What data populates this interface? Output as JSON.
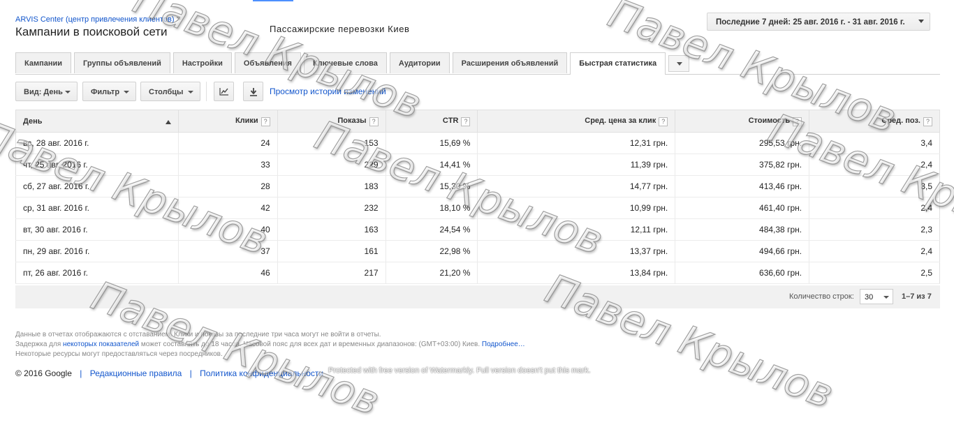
{
  "breadcrumb": {
    "account": "ARVIS Center (центр привлечения клиентов)",
    "separator": ">"
  },
  "page_title": "Кампании в поисковой сети",
  "campaign_name": "Пассажирские перевозки Киев",
  "date_range": "Последние 7 дней: 25 авг. 2016 г. - 31 авг. 2016 г.",
  "tabs": [
    {
      "label": "Кампании"
    },
    {
      "label": "Группы объявлений"
    },
    {
      "label": "Настройки"
    },
    {
      "label": "Объявления"
    },
    {
      "label": "Ключевые слова"
    },
    {
      "label": "Аудитории"
    },
    {
      "label": "Расширения объявлений"
    },
    {
      "label": "Быстрая статистика",
      "active": true
    }
  ],
  "toolbar": {
    "view": "Вид: День",
    "filter": "Фильтр",
    "columns": "Столбцы",
    "history_link": "Просмотр истории изменений"
  },
  "table": {
    "headers": [
      "День",
      "Клики",
      "Показы",
      "CTR",
      "Сред. цена за клик",
      "Стоимость",
      "Сред. поз."
    ],
    "help_glyph": "?",
    "rows": [
      [
        "вс, 28 авг. 2016 г.",
        "24",
        "153",
        "15,69 %",
        "12,31 грн.",
        "295,53 грн.",
        "3,4"
      ],
      [
        "чт, 25 авг. 2016 г.",
        "33",
        "229",
        "14,41 %",
        "11,39 грн.",
        "375,82 грн.",
        "2,4"
      ],
      [
        "сб, 27 авг. 2016 г.",
        "28",
        "183",
        "15,30 %",
        "14,77 грн.",
        "413,46 грн.",
        "3,5"
      ],
      [
        "ср, 31 авг. 2016 г.",
        "42",
        "232",
        "18,10 %",
        "10,99 грн.",
        "461,40 грн.",
        "2,4"
      ],
      [
        "вт, 30 авг. 2016 г.",
        "40",
        "163",
        "24,54 %",
        "12,11 грн.",
        "484,38 грн.",
        "2,3"
      ],
      [
        "пн, 29 авг. 2016 г.",
        "37",
        "161",
        "22,98 %",
        "13,37 грн.",
        "494,66 грн.",
        "2,4"
      ],
      [
        "пт, 26 авг. 2016 г.",
        "46",
        "217",
        "21,20 %",
        "13,84 грн.",
        "636,60 грн.",
        "2,5"
      ]
    ]
  },
  "pagination": {
    "rows_label": "Количество строк:",
    "rows_value": "30",
    "range": "1–7 из 7"
  },
  "notes": {
    "line1": "Данные в отчетах отображаются с отставанием. Клики и показы за последние три часа могут не войти в отчеты.",
    "line2_a": "Задержка для ",
    "line2_link": "некоторых показателей",
    "line2_b": " может составлять до 18 часов. Часовой пояс для всех дат и временных диапазонов: (GMT+03:00) Киев. ",
    "line2_more": "Подробнее…",
    "line3": "Некоторые ресурсы могут предоставляться через посредников."
  },
  "footer": {
    "copyright": "© 2016 Google",
    "editorial": "Редакционные правила",
    "privacy": "Политика конфиденциальности",
    "watermark_note": "Protected with free version of Watermarkly. Full version doesn't put this mark."
  },
  "watermark": {
    "text": "Павел Крылов"
  }
}
